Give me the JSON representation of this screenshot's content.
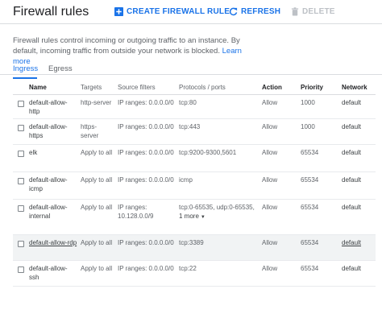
{
  "header": {
    "title": "Firewall rules",
    "create_label": "CREATE FIREWALL RULE",
    "refresh_label": "REFRESH",
    "delete_label": "DELETE"
  },
  "description": {
    "text": "Firewall rules control incoming or outgoing traffic to an instance. By default, incoming traffic from outside your network is blocked.",
    "link": "Learn more"
  },
  "tabs": [
    {
      "label": "Ingress",
      "active": true
    },
    {
      "label": "Egress",
      "active": false
    }
  ],
  "table": {
    "columns": [
      "Name",
      "Targets",
      "Source filters",
      "Protocols / ports",
      "Action",
      "Priority",
      "Network"
    ],
    "rows": [
      {
        "name": "default-allow-http",
        "targets": "http-server",
        "source": "IP ranges: 0.0.0.0/0",
        "protocols": "tcp:80",
        "more": "",
        "action": "Allow",
        "priority": "1000",
        "network": "default"
      },
      {
        "name": "default-allow-https",
        "targets": "https-server",
        "source": "IP ranges: 0.0.0.0/0",
        "protocols": "tcp:443",
        "more": "",
        "action": "Allow",
        "priority": "1000",
        "network": "default"
      },
      {
        "name": "elk",
        "targets": "Apply to all",
        "source": "IP ranges: 0.0.0.0/0",
        "protocols": "tcp:9200-9300,5601",
        "more": "",
        "action": "Allow",
        "priority": "65534",
        "network": "default"
      },
      {
        "name": "default-allow-icmp",
        "targets": "Apply to all",
        "source": "IP ranges: 0.0.0.0/0",
        "protocols": "icmp",
        "more": "",
        "action": "Allow",
        "priority": "65534",
        "network": "default"
      },
      {
        "name": "default-allow-internal",
        "targets": "Apply to all",
        "source": "IP ranges: 10.128.0.0/9",
        "protocols": "tcp:0-65535, udp:0-65535,",
        "more": "1 more",
        "action": "Allow",
        "priority": "65534",
        "network": "default"
      },
      {
        "name": "default-allow-rdp",
        "targets": "Apply to all",
        "source": "IP ranges: 0.0.0.0/0",
        "protocols": "tcp:3389",
        "more": "",
        "action": "Allow",
        "priority": "65534",
        "network": "default"
      },
      {
        "name": "default-allow-ssh",
        "targets": "Apply to all",
        "source": "IP ranges: 0.0.0.0/0",
        "protocols": "tcp:22",
        "more": "",
        "action": "Allow",
        "priority": "65534",
        "network": "default"
      }
    ]
  },
  "icons": {
    "create": "add-box-icon",
    "refresh": "refresh-icon",
    "delete": "trash-icon",
    "more_caret": "caret-down-icon"
  },
  "colors": {
    "accent": "#1a73e8",
    "disabled": "#bdc1c6",
    "text": "#202124",
    "muted": "#5f6368",
    "hover_row": "#f1f3f4"
  }
}
